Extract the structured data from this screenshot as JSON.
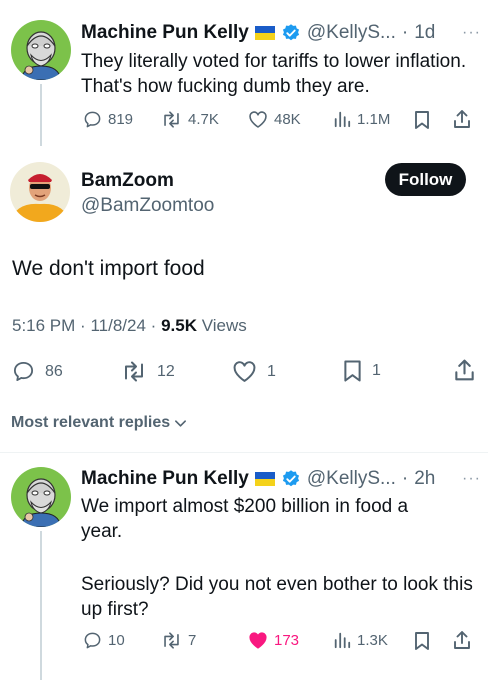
{
  "tweet1": {
    "name": "Machine Pun Kelly",
    "handle": "@KellyS...",
    "sep": "·",
    "time": "1d",
    "more": "···",
    "text": "They literally voted for tariffs to lower inflation. That's how fucking dumb they are.",
    "replies": "819",
    "reposts": "4.7K",
    "likes": "48K",
    "views": "1.1M"
  },
  "main": {
    "name": "BamZoom",
    "handle": "@BamZoomtoo",
    "follow_label": "Follow",
    "text": "We don't import food",
    "time": "5:16 PM",
    "date": "11/8/24",
    "sep": "·",
    "views_count": "9.5K",
    "views_label": "Views",
    "replies": "86",
    "reposts": "12",
    "likes": "1",
    "bookmarks": "1"
  },
  "replies_filter": {
    "label": "Most relevant replies"
  },
  "tweet2": {
    "name": "Machine Pun Kelly",
    "handle": "@KellyS...",
    "sep": "·",
    "time": "2h",
    "more": "···",
    "text_line1": "We import almost $200 billion in food a year.",
    "text_line2": "Seriously? Did you not even bother to look this up first?",
    "replies": "10",
    "reposts": "7",
    "likes": "173",
    "views": "1.3K"
  },
  "colors": {
    "text": "#0f1419",
    "secondary": "#536471",
    "verified": "#1d9bf0",
    "like_active": "#f91880"
  }
}
